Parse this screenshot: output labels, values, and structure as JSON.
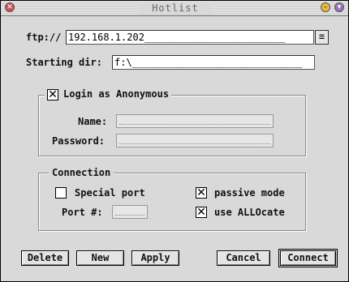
{
  "window": {
    "title": "Hotlist"
  },
  "form": {
    "ftp_label": "ftp://",
    "ftp_value": "192.168.1.202________________________",
    "dropdown_glyph": "≡",
    "start_dir_label": "Starting dir:",
    "start_dir_value": "f:\\_____________________________"
  },
  "login_group": {
    "checkbox_label": "Login as Anonymous",
    "checked": true,
    "check_mark": "✕",
    "name_label": "Name:",
    "password_label": "Password:"
  },
  "connection_group": {
    "title": "Connection",
    "special_port_label": "Special port",
    "special_port_checked": false,
    "port_label": "Port #:",
    "passive_mode_label": "passive mode",
    "passive_mode_checked": true,
    "use_allocate_label": "use ALLOcate",
    "use_allocate_checked": true,
    "check_mark": "✕"
  },
  "buttons": {
    "delete": "Delete",
    "new": "New",
    "apply": "Apply",
    "cancel": "Cancel",
    "connect": "Connect"
  }
}
